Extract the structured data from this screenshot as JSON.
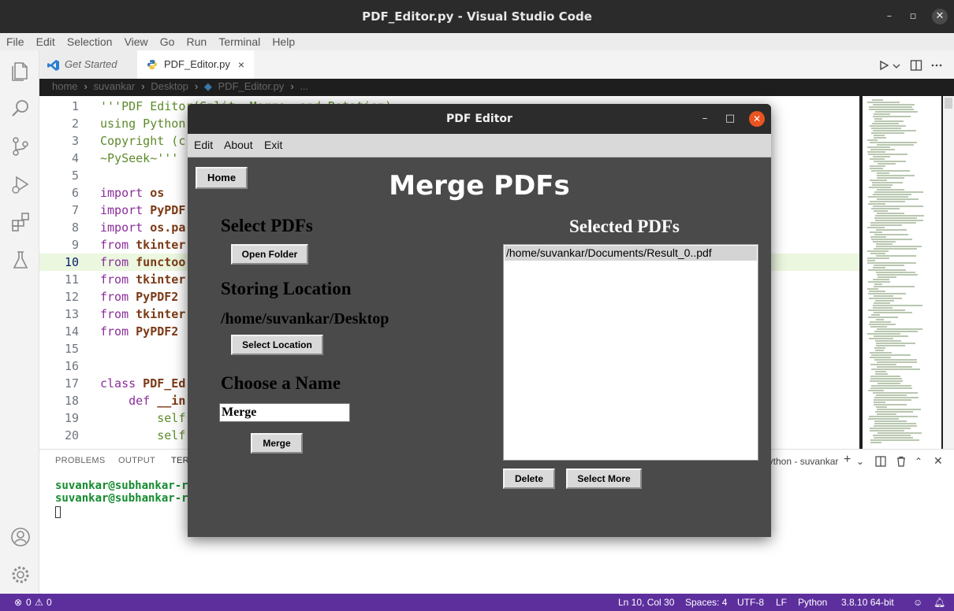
{
  "window": {
    "title": "PDF_Editor.py - Visual Studio Code"
  },
  "menu": [
    "File",
    "Edit",
    "Selection",
    "View",
    "Go",
    "Run",
    "Terminal",
    "Help"
  ],
  "tabs": [
    {
      "label": "Get Started"
    },
    {
      "label": "PDF_Editor.py",
      "close": "×"
    }
  ],
  "breadcrumb": [
    "home",
    "suvankar",
    "Desktop",
    "PDF_Editor.py",
    "..."
  ],
  "editor": {
    "current_line": 10,
    "lines": [
      {
        "n": "1",
        "text": "'''PDF Editor(Split, Merge, and Rotation)"
      },
      {
        "n": "2",
        "text": "using Python"
      },
      {
        "n": "3",
        "text": "Copyright (c"
      },
      {
        "n": "4",
        "text": "~PySeek~'''"
      },
      {
        "n": "5",
        "text": ""
      },
      {
        "n": "6",
        "kw": "import",
        "rest": " os"
      },
      {
        "n": "7",
        "kw": "import",
        "rest": " PyPDF"
      },
      {
        "n": "8",
        "kw": "import",
        "rest": " os.pa"
      },
      {
        "n": "9",
        "kw": "from",
        "rest": " tkinter"
      },
      {
        "n": "10",
        "kw": "from",
        "rest": " functoo"
      },
      {
        "n": "11",
        "kw": "from",
        "rest": " tkinter"
      },
      {
        "n": "12",
        "kw": "from",
        "rest": " PyPDF2"
      },
      {
        "n": "13",
        "kw": "from",
        "rest": " tkinter"
      },
      {
        "n": "14",
        "kw": "from",
        "rest": " PyPDF2"
      },
      {
        "n": "15",
        "text": ""
      },
      {
        "n": "16",
        "text": ""
      },
      {
        "n": "17",
        "kw": "class",
        "rest": " PDF_Ed"
      },
      {
        "n": "18",
        "kw": "    def",
        "rest": " __in"
      },
      {
        "n": "19",
        "text": "        self"
      },
      {
        "n": "20",
        "text": "        self"
      }
    ]
  },
  "panel": {
    "tabs": [
      "PROBLEMS",
      "OUTPUT",
      "TERMINAL"
    ],
    "terminal_lines": [
      "suvankar@subhankar-ra",
      "suvankar@subhankar-ra"
    ],
    "terminal_name": "python - suvankar"
  },
  "statusbar": {
    "errors": "0",
    "warnings": "0",
    "position": "Ln 10, Col 30",
    "spaces": "Spaces: 4",
    "encoding": "UTF-8",
    "eol": "LF",
    "language": "Python",
    "interpreter": "3.8.10 64-bit"
  },
  "app": {
    "title": "PDF Editor",
    "menu": [
      "Edit",
      "About",
      "Exit"
    ],
    "home_button": "Home",
    "heading": "Merge PDFs",
    "select_pdfs_label": "Select PDFs",
    "open_folder_button": "Open Folder",
    "storing_location_label": "Storing Location",
    "storing_path": "/home/suvankar/Desktop",
    "select_location_button": "Select Location",
    "choose_name_label": "Choose a Name",
    "name_value": "Merge",
    "merge_button": "Merge",
    "selected_pdfs_label": "Selected PDFs",
    "selected_files": [
      "/home/suvankar/Documents/Result_0..pdf"
    ],
    "delete_button": "Delete",
    "select_more_button": "Select More"
  },
  "colors": {
    "statusbar": "#5d2f9d",
    "app_background": "#4a4a4a",
    "close_button": "#e95420",
    "keyword": "#8a2e9a",
    "string": "#5d8a2a",
    "terminal_text": "#158b2f"
  }
}
